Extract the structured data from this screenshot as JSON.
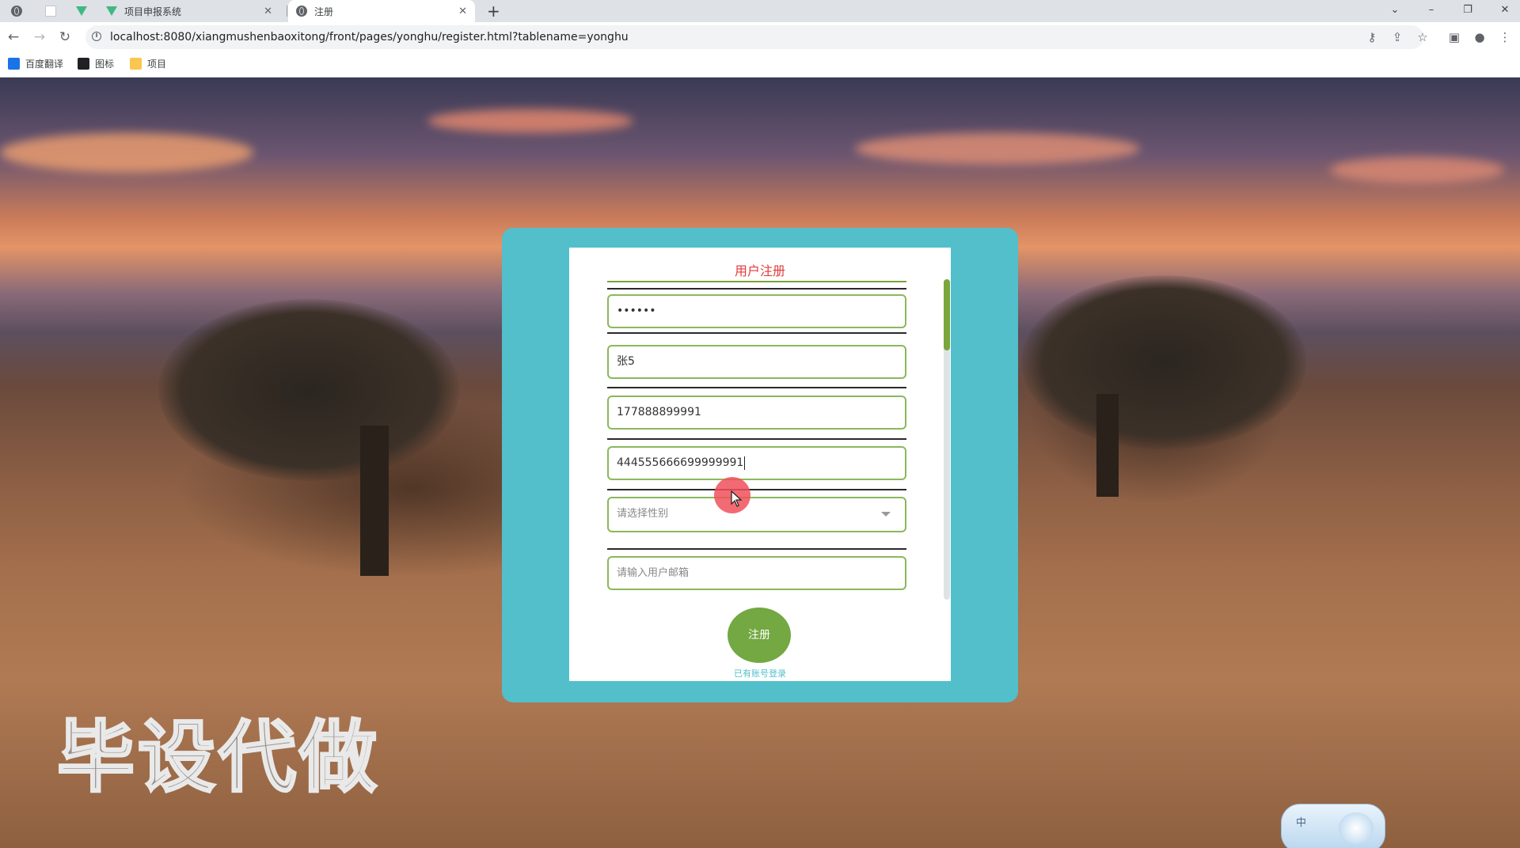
{
  "browser": {
    "tabs": [
      {
        "title": "",
        "icon": "globe-icon"
      },
      {
        "title": "",
        "icon": "blank-page-icon"
      },
      {
        "title": "",
        "icon": "vue-logo-icon"
      },
      {
        "title": "项目申报系统",
        "icon": "vue-logo-icon"
      },
      {
        "title": "注册",
        "icon": "globe-icon",
        "active": true
      }
    ],
    "url": "localhost:8080/xiangmushenbaoxitong/front/pages/yonghu/register.html?tablename=yonghu",
    "bookmarks": [
      {
        "label": "百度翻译",
        "icon": "translate-icon",
        "color": "#1a73e8"
      },
      {
        "label": "图标",
        "icon": "image-icon",
        "color": "#202124"
      },
      {
        "label": "项目",
        "icon": "folder-icon",
        "color": "#f9c74f"
      }
    ]
  },
  "form": {
    "title": "用户注册",
    "password_value": "••••••",
    "name_value": "张5",
    "phone_value": "177888899991",
    "idcard_value": "444555666699999991",
    "gender_placeholder": "请选择性别",
    "email_placeholder": "请输入用户邮箱",
    "register_label": "注册",
    "login_link": "已有账号登录"
  },
  "overlay": {
    "watermark": "毕设代做",
    "ime_label": "中"
  },
  "colors": {
    "card": "#52bfcb",
    "accent_green": "#73a842",
    "title_red": "#e23a3a"
  }
}
